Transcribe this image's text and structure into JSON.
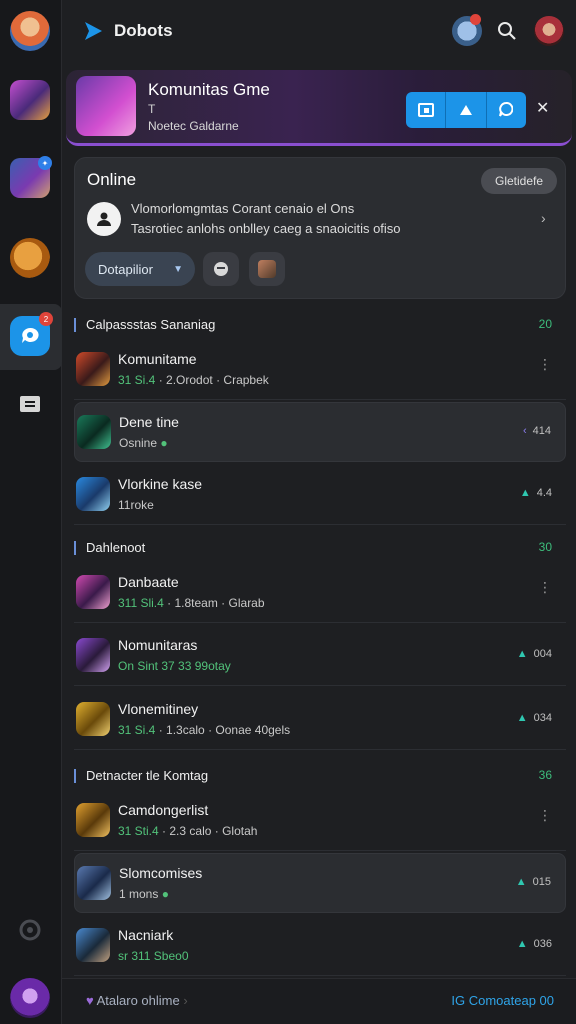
{
  "app": {
    "title": "Dobots",
    "accent": "#1c94e8"
  },
  "rail": {
    "notif_count": "2"
  },
  "banner": {
    "title": "Komunitas Gme",
    "sub1": "T",
    "sub2": "Noetec Galdarne",
    "actions": [
      "window-icon",
      "shape-icon",
      "chat-icon"
    ],
    "close_icon": "close-icon"
  },
  "online_card": {
    "title": "Online",
    "pill": "Gletidefe",
    "line1": "Vlomorlomgmtas Corant cenaio el Ons",
    "line2": "Tasrotiec anlohs onblley caeg a snaoicitis ofiso",
    "dropdown": "Dotapilior"
  },
  "sections": [
    {
      "title": "Calpassstas Sananiag",
      "count": "20"
    },
    {
      "title": "Dahlenoot",
      "count": "30"
    },
    {
      "title": "Detnacter tle Komtag",
      "count": "36"
    }
  ],
  "rows": [
    {
      "name": "Komunitame",
      "sub_g": "31 Si.4",
      "sub": "2.Orodot",
      "sub2": "Crapbek",
      "right": ""
    },
    {
      "name": "Dene tine",
      "sub_g": "",
      "sub": "Osnine",
      "sub2": "",
      "right": "414"
    },
    {
      "name": "Vlorkine kase",
      "sub_g": "",
      "sub": "11roke",
      "sub2": "",
      "right": "4.4"
    },
    {
      "name": "Danbaate",
      "sub_g": "311 Sli.4",
      "sub": "1.8team",
      "sub2": "Glarab",
      "right": ""
    },
    {
      "name": "Nomunitaras",
      "sub_g": "On Sint 37",
      "sub": "33 99otay",
      "sub2": "",
      "right": "004"
    },
    {
      "name": "Vlonemitiney",
      "sub_g": "31 Si.4",
      "sub": "1.3calo",
      "sub2": "Oonae 40gels",
      "right": "034"
    },
    {
      "name": "Camdongerlist",
      "sub_g": "31 Sti.4",
      "sub": "2.3 calo",
      "sub2": "Glotah",
      "right": ""
    },
    {
      "name": "Slomcomises",
      "sub_g": "",
      "sub": "1 mons",
      "sub2": "",
      "right": "015"
    },
    {
      "name": "Nacniark",
      "sub_g": "sr 311 Sbeo0",
      "sub": "",
      "sub2": "",
      "right": "036"
    }
  ],
  "footer": {
    "left": "Atalaro ohlime",
    "right": "IG Comoateap 00"
  }
}
